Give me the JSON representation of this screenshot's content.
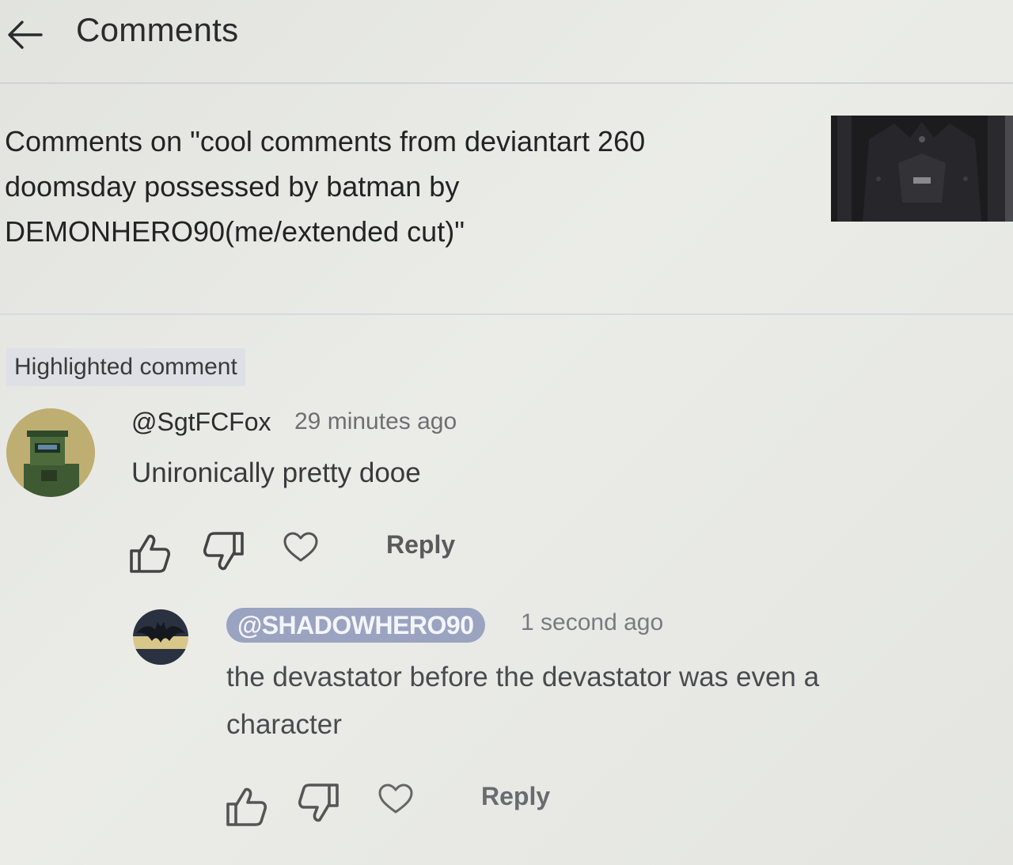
{
  "header": {
    "title": "Comments",
    "back_icon": "arrow-left-icon"
  },
  "video": {
    "title": "Comments on \"cool comments from deviantart 260\ndoomsday possessed by batman by\nDEMONHERO90(me/extended cut)\""
  },
  "highlight_label": "Highlighted comment",
  "comments": [
    {
      "author": "@SgtFCFox",
      "time": "29 minutes ago",
      "text": "Unironically pretty dooe",
      "reply_label": "Reply"
    },
    {
      "author": "@SHADOWHERO90",
      "time": "1 second ago",
      "text": "the devastator before the devastator was even a\ncharacter",
      "reply_label": "Reply"
    }
  ],
  "icons": {
    "like": "thumbs-up-icon",
    "dislike": "thumbs-down-icon",
    "heart": "heart-icon"
  },
  "colors": {
    "background": "#e6e7e3",
    "author_chip": "#9aa3c0",
    "divider": "#cfd3dd"
  }
}
